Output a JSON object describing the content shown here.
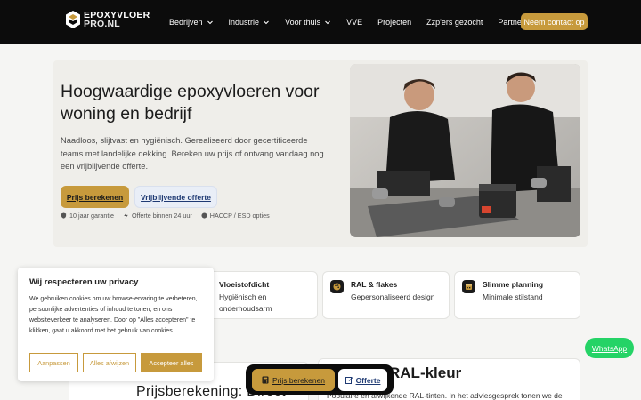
{
  "brand": {
    "line1": "EPOXYVLOER",
    "line2": "PRO.NL"
  },
  "nav": {
    "items": [
      {
        "label": "Bedrijven",
        "dropdown": true
      },
      {
        "label": "Industrie",
        "dropdown": true
      },
      {
        "label": "Voor thuis",
        "dropdown": true
      },
      {
        "label": "VVE",
        "dropdown": false
      },
      {
        "label": "Projecten",
        "dropdown": false
      },
      {
        "label": "Zzp'ers gezocht",
        "dropdown": false
      },
      {
        "label": "Partners",
        "dropdown": false
      }
    ],
    "cta": "Neem contact op"
  },
  "hero": {
    "title": "Hoogwaardige epoxyvloeren voor woning en bedrijf",
    "description": "Naadloos, slijtvast en hygiënisch. Gerealiseerd door gecertificeerde teams met landelijke dekking. Bereken uw prijs of ontvang vandaag nog een vrijblijvende offerte.",
    "primary_button": "Prijs berekenen",
    "secondary_button": "Vrijblijvende offerte",
    "badges": [
      "10 jaar garantie",
      "Offerte binnen 24 uur",
      "HACCP / ESD opties"
    ]
  },
  "features": [
    {
      "title": "Vloeistofdicht",
      "subtitle": "Hygiënisch en onderhoudsarm",
      "icon": "droplet-icon"
    },
    {
      "title": "RAL & flakes",
      "subtitle": "Gepersonaliseerd design",
      "icon": "palette-icon"
    },
    {
      "title": "Slimme planning",
      "subtitle": "Minimale stilstand",
      "icon": "calendar-icon"
    }
  ],
  "lower": {
    "left_title": "Prijsberekening: Direct",
    "right_title": "RAL-kleur",
    "right_text": "Populaire en afwijkende RAL-tinten. In het adviesgesprek tonen we de"
  },
  "cookie": {
    "title": "Wij respecteren uw privacy",
    "text": "We gebruiken cookies om uw browse-ervaring te verbeteren, persoonlijke advertenties of inhoud te tonen, en ons websiteverkeer te analyseren. Door op \"Alles accepteren\" te klikken, gaat u akkoord met het gebruik van cookies.",
    "customize": "Aanpassen",
    "reject": "Alles afwijzen",
    "accept": "Accepteer alles"
  },
  "sticky": {
    "primary": "Prijs berekenen",
    "secondary": "Offerte"
  },
  "whatsapp": "WhatsApp",
  "colors": {
    "accent": "#c79a3c",
    "nav_bg": "#0c0c0c",
    "whatsapp": "#25d366",
    "link_blue": "#1f3a73"
  }
}
